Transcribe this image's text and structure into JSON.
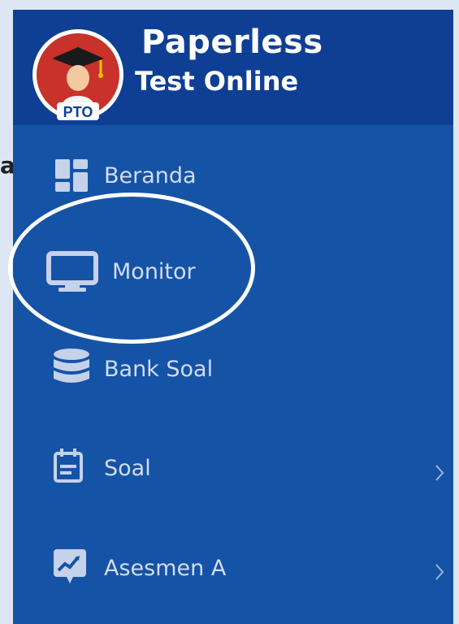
{
  "app": {
    "title_line1": "Paperless",
    "title_line2": "Test Online",
    "logo_text": "PTO"
  },
  "left_fragment": "a",
  "sidebar": {
    "items": [
      {
        "label": "Beranda",
        "icon": "dashboard-icon",
        "has_submenu": false
      },
      {
        "label": "Monitor",
        "icon": "monitor-icon",
        "has_submenu": false
      },
      {
        "label": "Bank Soal",
        "icon": "database-icon",
        "has_submenu": false
      },
      {
        "label": "Soal",
        "icon": "calendar-list-icon",
        "has_submenu": true
      },
      {
        "label": "Asesmen A",
        "icon": "chart-card-icon",
        "has_submenu": true
      }
    ]
  },
  "annotation": {
    "highlighted_item": "Monitor"
  },
  "colors": {
    "sidebar_bg": "#1553a6",
    "brand_bg": "#0f3f95",
    "page_bg": "#dde7f4",
    "menu_text": "#d2dcf0",
    "logo_red": "#c8322a"
  }
}
